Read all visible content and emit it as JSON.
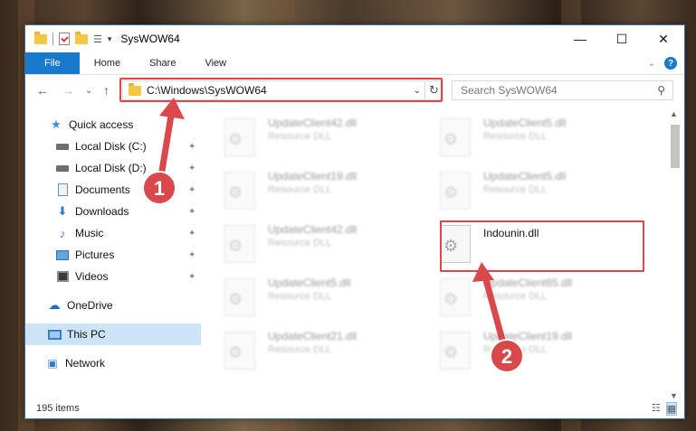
{
  "window": {
    "title": "SysWOW64",
    "controls": {
      "minimize": "—",
      "maximize": "☐",
      "close": "✕"
    }
  },
  "ribbon": {
    "tabs": [
      "File",
      "Home",
      "Share",
      "View"
    ],
    "help_glyph": "?",
    "collapse_glyph": "⌄"
  },
  "nav": {
    "address": "C:\\Windows\\SysWOW64",
    "search_placeholder": "Search SysWOW64",
    "glyphs": {
      "back": "←",
      "forward": "→",
      "recent": "⌄",
      "up": "↑",
      "refresh": "↻",
      "dropdown": "⌄",
      "search": "⚲"
    }
  },
  "sidebar": {
    "items": [
      {
        "label": "Quick access",
        "icon": "star-icon",
        "pinned": false
      },
      {
        "label": "Local Disk (C:)",
        "icon": "drive-icon",
        "pinned": true
      },
      {
        "label": "Local Disk (D:)",
        "icon": "drive-icon",
        "pinned": true
      },
      {
        "label": "Documents",
        "icon": "documents-icon",
        "pinned": true
      },
      {
        "label": "Downloads",
        "icon": "download-icon",
        "pinned": true
      },
      {
        "label": "Music",
        "icon": "music-icon",
        "pinned": true
      },
      {
        "label": "Pictures",
        "icon": "pictures-icon",
        "pinned": true
      },
      {
        "label": "Videos",
        "icon": "videos-icon",
        "pinned": true
      },
      {
        "label": "OneDrive",
        "icon": "cloud-icon",
        "pinned": false
      },
      {
        "label": "This PC",
        "icon": "pc-icon",
        "pinned": false,
        "selected": true
      },
      {
        "label": "Network",
        "icon": "network-icon",
        "pinned": false
      }
    ],
    "glyphs": {
      "star": "★",
      "download": "⬇",
      "music": "♪",
      "cloud": "☁",
      "network": "🖧",
      "pin": "📌"
    }
  },
  "files": [
    {
      "name": "UpdateClient42.dll",
      "type": "Resource DLL",
      "blurred": true
    },
    {
      "name": "UpdateClient5.dll",
      "type": "Resource DLL",
      "blurred": true
    },
    {
      "name": "UpdateClient19.dll",
      "type": "Resource DLL",
      "blurred": true
    },
    {
      "name": "UpdateClient5.dll",
      "type": "Resource DLL",
      "blurred": true
    },
    {
      "name": "UpdateClient42.dll",
      "type": "Resource DLL",
      "blurred": true
    },
    {
      "name": "Indounin.dll",
      "type": "",
      "blurred": false,
      "highlighted": true
    },
    {
      "name": "UpdateClient5.dll",
      "type": "Resource DLL",
      "blurred": true
    },
    {
      "name": "UpdateClient65.dll",
      "type": "Resource DLL",
      "blurred": true
    },
    {
      "name": "UpdateClient21.dll",
      "type": "Resource DLL",
      "blurred": true
    },
    {
      "name": "UpdateClient19.dll",
      "type": "Resource DLL",
      "blurred": true
    }
  ],
  "status": {
    "item_count": "195 items"
  },
  "annotations": {
    "step1": "1",
    "step2": "2"
  },
  "colors": {
    "accent": "#1979ca",
    "highlight_red": "#d9484b",
    "selected_bg": "#cce4f7"
  }
}
